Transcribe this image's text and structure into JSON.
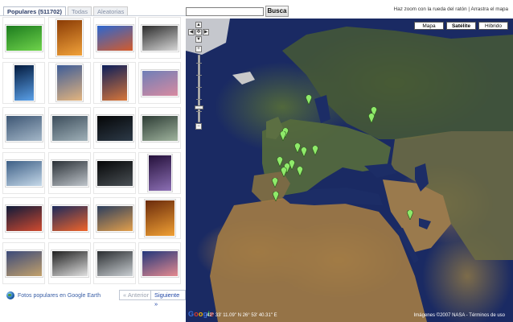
{
  "tabs": [
    {
      "label": "Populares (511702)",
      "active": true
    },
    {
      "label": "Todas",
      "active": false
    },
    {
      "label": "Aleatorias",
      "active": false
    }
  ],
  "photos": [
    {
      "name": "photo-green-leaf",
      "colors": [
        "#1c7b1e",
        "#6fd34b"
      ]
    },
    {
      "name": "photo-sunset-ruin",
      "colors": [
        "#8a3b05",
        "#f1a23a"
      ]
    },
    {
      "name": "photo-desert-dune",
      "colors": [
        "#2b67d1",
        "#d45b2b"
      ]
    },
    {
      "name": "photo-castle-bw",
      "colors": [
        "#2b2b2b",
        "#d7d7d7"
      ]
    },
    {
      "name": "photo-burj-night",
      "colors": [
        "#031a3d",
        "#5aa0e8"
      ]
    },
    {
      "name": "photo-beach-dusk",
      "colors": [
        "#3d5c98",
        "#e3b47e"
      ]
    },
    {
      "name": "photo-palm-sunset",
      "colors": [
        "#0b1e5a",
        "#d7763a"
      ]
    },
    {
      "name": "photo-pink-lake",
      "colors": [
        "#6f7fb8",
        "#d88aa0"
      ]
    },
    {
      "name": "photo-mountain-lake",
      "colors": [
        "#3d5674",
        "#a4b7c8"
      ]
    },
    {
      "name": "photo-lake-mist",
      "colors": [
        "#3c4d5b",
        "#9fb0b8"
      ]
    },
    {
      "name": "photo-moon-night",
      "colors": [
        "#050607",
        "#2d3a48"
      ]
    },
    {
      "name": "photo-chateau",
      "colors": [
        "#2d3c35",
        "#9fb39d"
      ]
    },
    {
      "name": "photo-alpine-church",
      "colors": [
        "#3d5f86",
        "#c6d9e9"
      ]
    },
    {
      "name": "photo-foggy-peaks",
      "colors": [
        "#2a3036",
        "#bfc5cb"
      ]
    },
    {
      "name": "photo-dark-forest",
      "colors": [
        "#050607",
        "#4a5055"
      ]
    },
    {
      "name": "photo-night-tower",
      "colors": [
        "#24103a",
        "#8c6fb4"
      ]
    },
    {
      "name": "photo-red-square",
      "colors": [
        "#0e1a3a",
        "#d04a2f"
      ]
    },
    {
      "name": "photo-fire-clouds",
      "colors": [
        "#1b2a5c",
        "#f0642a"
      ]
    },
    {
      "name": "photo-sunset-reflect",
      "colors": [
        "#2b3e5e",
        "#e39f4b"
      ]
    },
    {
      "name": "photo-orange-sky",
      "colors": [
        "#6a2a0b",
        "#f0a034"
      ]
    },
    {
      "name": "photo-modern-building",
      "colors": [
        "#3b4a7a",
        "#c3a16b"
      ]
    },
    {
      "name": "photo-lone-tree",
      "colors": [
        "#1f1f1f",
        "#e0e0e0"
      ]
    },
    {
      "name": "photo-spider-sculpture",
      "colors": [
        "#2a2d30",
        "#c9ced2"
      ]
    },
    {
      "name": "photo-pink-sunset",
      "colors": [
        "#22367a",
        "#e58a8f"
      ]
    }
  ],
  "footer": {
    "earth_link": "Fotos populares en Google Earth",
    "prev": "« Anterior",
    "next": "Siguiente »"
  },
  "search": {
    "button": "Busca",
    "value": ""
  },
  "hint": "Haz zoom con la rueda del ratón | Arrastra el mapa",
  "map_types": [
    {
      "label": "Mapa",
      "selected": false
    },
    {
      "label": "Satélite",
      "selected": true
    },
    {
      "label": "Híbrido",
      "selected": false
    }
  ],
  "coords": "42° 33' 11.09\" N 26° 53' 40.31\" E",
  "copyright": "Imágenes ©2007 NASA - Términos de uso",
  "logo": "Google",
  "marker_color": "#8fea6a"
}
